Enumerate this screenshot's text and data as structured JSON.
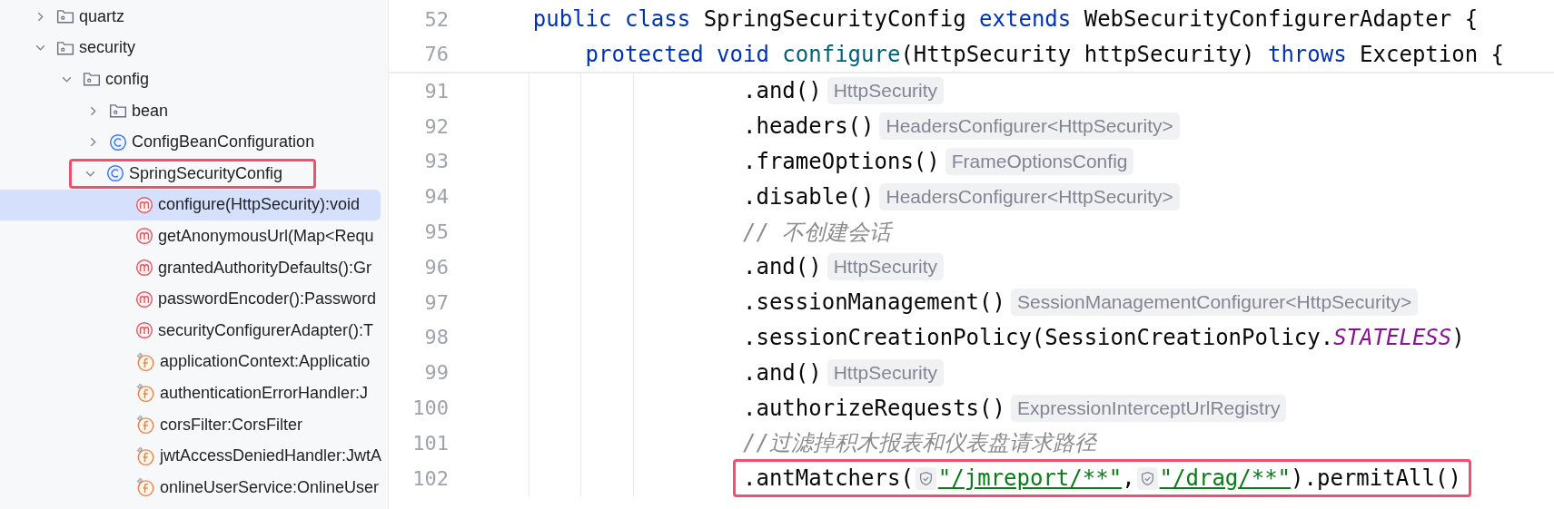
{
  "tree": [
    {
      "kind": "folder",
      "label": "quartz",
      "expanded": false,
      "selected": false,
      "highlighted": false
    },
    {
      "kind": "folder",
      "label": "security",
      "expanded": true,
      "selected": false,
      "highlighted": false,
      "children": [
        {
          "kind": "folder",
          "label": "config",
          "expanded": true,
          "selected": false,
          "highlighted": false,
          "children": [
            {
              "kind": "folder",
              "label": "bean",
              "expanded": false,
              "selected": false,
              "highlighted": false
            },
            {
              "kind": "class",
              "label": "ConfigBeanConfiguration",
              "expanded": false,
              "selected": false,
              "highlighted": false
            },
            {
              "kind": "class",
              "label": "SpringSecurityConfig",
              "expanded": true,
              "selected": false,
              "highlighted": true,
              "children": [
                {
                  "kind": "method",
                  "label": "configure(HttpSecurity):void",
                  "selected": true,
                  "highlighted": false
                },
                {
                  "kind": "method",
                  "label": "getAnonymousUrl(Map<Requ",
                  "selected": false,
                  "highlighted": false
                },
                {
                  "kind": "method",
                  "label": "grantedAuthorityDefaults():Gr",
                  "selected": false,
                  "highlighted": false
                },
                {
                  "kind": "method",
                  "label": "passwordEncoder():Password",
                  "selected": false,
                  "highlighted": false
                },
                {
                  "kind": "method",
                  "label": "securityConfigurerAdapter():T",
                  "selected": false,
                  "highlighted": false
                },
                {
                  "kind": "field",
                  "label": "applicationContext:Applicatio",
                  "selected": false,
                  "highlighted": false
                },
                {
                  "kind": "field",
                  "label": "authenticationErrorHandler:J",
                  "selected": false,
                  "highlighted": false
                },
                {
                  "kind": "field",
                  "label": "corsFilter:CorsFilter",
                  "selected": false,
                  "highlighted": false
                },
                {
                  "kind": "field",
                  "label": "jwtAccessDeniedHandler:JwtA",
                  "selected": false,
                  "highlighted": false
                },
                {
                  "kind": "field",
                  "label": "onlineUserService:OnlineUser",
                  "selected": false,
                  "highlighted": false
                }
              ]
            }
          ]
        }
      ]
    }
  ],
  "sticky_lines": [
    {
      "number": "52",
      "tokens": [
        {
          "kind": "keyword",
          "text": "public class"
        },
        {
          "kind": "plain",
          "text": " SpringSecurityConfig "
        },
        {
          "kind": "keyword",
          "text": "extends"
        },
        {
          "kind": "plain",
          "text": " WebSecurityConfigurerAdapter {"
        }
      ]
    },
    {
      "number": "76",
      "tokens": [
        {
          "kind": "keyword",
          "text": "protected void"
        },
        {
          "kind": "function",
          "text": " configure"
        },
        {
          "kind": "plain",
          "text": "(HttpSecurity httpSecurity) "
        },
        {
          "kind": "keyword",
          "text": "throws"
        },
        {
          "kind": "plain",
          "text": " Exception {"
        }
      ]
    }
  ],
  "lines": [
    {
      "number": "91",
      "highlighted": false,
      "tokens": [
        {
          "kind": "plain",
          "text": ".and()"
        },
        {
          "kind": "hint",
          "text": "HttpSecurity"
        }
      ]
    },
    {
      "number": "92",
      "highlighted": false,
      "tokens": [
        {
          "kind": "plain",
          "text": ".headers()"
        },
        {
          "kind": "hint",
          "text": "HeadersConfigurer<HttpSecurity>"
        }
      ]
    },
    {
      "number": "93",
      "highlighted": false,
      "tokens": [
        {
          "kind": "plain",
          "text": ".frameOptions()"
        },
        {
          "kind": "hint",
          "text": "FrameOptionsConfig"
        }
      ]
    },
    {
      "number": "94",
      "highlighted": false,
      "tokens": [
        {
          "kind": "plain",
          "text": ".disable()"
        },
        {
          "kind": "hint",
          "text": "HeadersConfigurer<HttpSecurity>"
        }
      ]
    },
    {
      "number": "95",
      "highlighted": false,
      "tokens": [
        {
          "kind": "comment",
          "text": "// 不创建会话"
        }
      ]
    },
    {
      "number": "96",
      "highlighted": false,
      "tokens": [
        {
          "kind": "plain",
          "text": ".and()"
        },
        {
          "kind": "hint",
          "text": "HttpSecurity"
        }
      ]
    },
    {
      "number": "97",
      "highlighted": false,
      "tokens": [
        {
          "kind": "plain",
          "text": ".sessionManagement()"
        },
        {
          "kind": "hint",
          "text": "SessionManagementConfigurer<HttpSecurity>"
        }
      ]
    },
    {
      "number": "98",
      "highlighted": false,
      "tokens": [
        {
          "kind": "plain",
          "text": ".sessionCreationPolicy(SessionCreationPolicy."
        },
        {
          "kind": "constant",
          "text": "STATELESS"
        },
        {
          "kind": "plain",
          "text": ")"
        }
      ]
    },
    {
      "number": "99",
      "highlighted": false,
      "tokens": [
        {
          "kind": "plain",
          "text": ".and()"
        },
        {
          "kind": "hint",
          "text": "HttpSecurity"
        }
      ]
    },
    {
      "number": "100",
      "highlighted": false,
      "tokens": [
        {
          "kind": "plain",
          "text": ".authorizeRequests()"
        },
        {
          "kind": "hint",
          "text": "ExpressionInterceptUrlRegistry"
        }
      ]
    },
    {
      "number": "101",
      "highlighted": false,
      "tokens": [
        {
          "kind": "comment",
          "text": "//过滤掉积木报表和仪表盘请求路径"
        }
      ]
    },
    {
      "number": "102",
      "highlighted": true,
      "tokens": [
        {
          "kind": "plain",
          "text": ".antMatchers("
        },
        {
          "kind": "shield"
        },
        {
          "kind": "string",
          "text": "\"/jmreport/**\""
        },
        {
          "kind": "plain",
          "text": ","
        },
        {
          "kind": "shield"
        },
        {
          "kind": "string",
          "text": "\"/drag/**\""
        },
        {
          "kind": "plain",
          "text": ").permitAll()"
        }
      ]
    }
  ]
}
